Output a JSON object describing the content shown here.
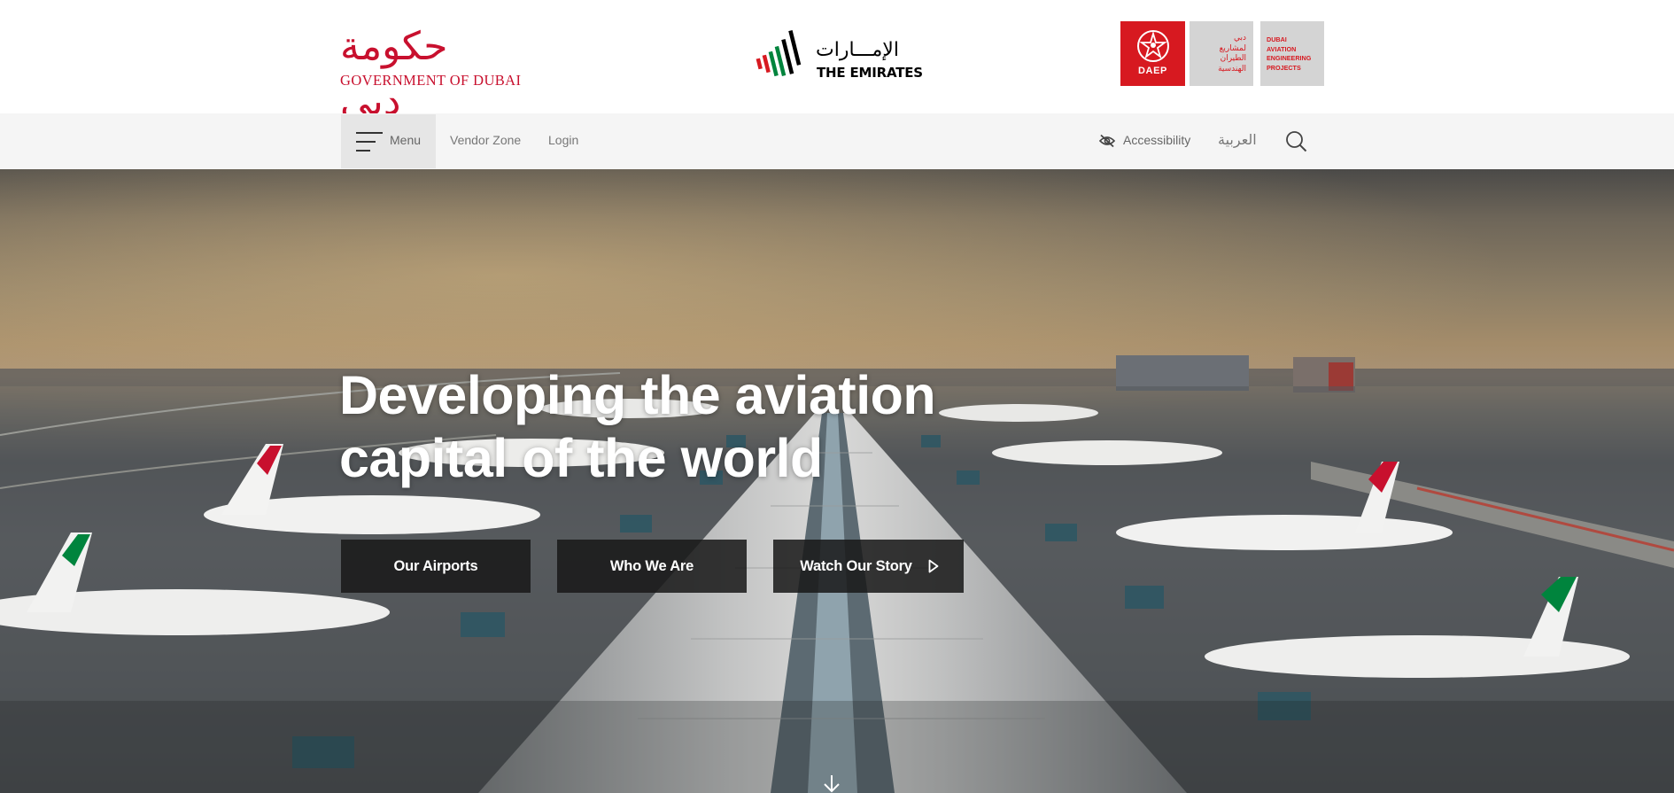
{
  "header": {
    "gov_logo": {
      "arabic": "حكومة دبي",
      "latin": "GOVERNMENT OF DUBAI"
    },
    "uae_logo": {
      "arabic": "الإمـــارات",
      "latin": "THE EMIRATES",
      "bar_colors": [
        "#d71920",
        "#00843d",
        "#000000"
      ]
    },
    "daep_logo": {
      "abbr": "DAEP",
      "arabic_lines": [
        "دبي",
        "لمشاريع",
        "الطيران",
        "الهندسية"
      ],
      "english_lines": [
        "DUBAI",
        "AVIATION",
        "ENGINEERING",
        "PROJECTS"
      ],
      "brand_color": "#d71920"
    }
  },
  "nav": {
    "menu_label": "Menu",
    "menu_icon": "hamburger-icon",
    "links": [
      "Vendor Zone",
      "Login"
    ],
    "accessibility_label": "Accessibility",
    "accessibility_icon": "eye-slash-icon",
    "language_label": "العربية",
    "search_icon": "search-icon"
  },
  "hero": {
    "title_line1": "Developing the aviation",
    "title_line2": "capital of the world",
    "buttons": [
      "Our Airports",
      "Who We Are",
      "Watch Our Story"
    ],
    "play_icon": "play-icon",
    "scroll_icon": "arrow-down-icon"
  }
}
